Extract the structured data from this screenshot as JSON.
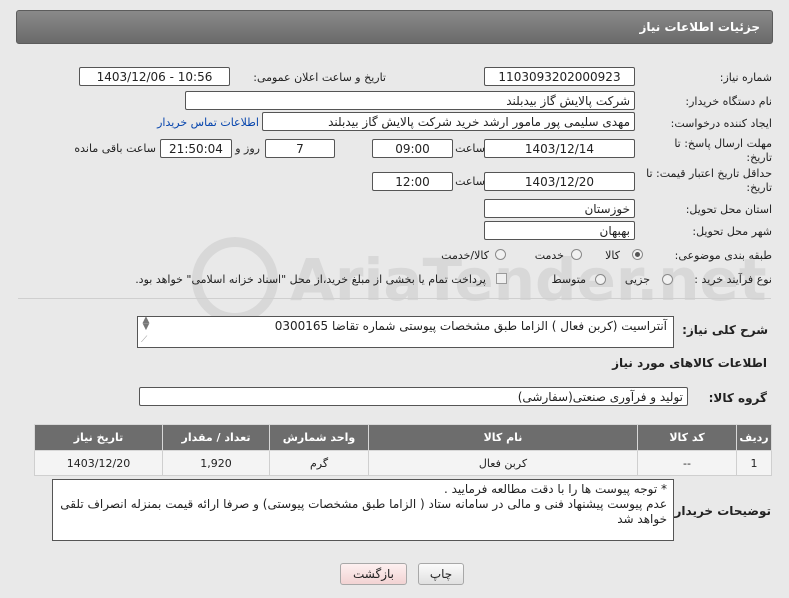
{
  "header": {
    "title": "جزئیات اطلاعات نیاز"
  },
  "form": {
    "need_number_label": "شماره نیاز:",
    "need_number": "1103093202000923",
    "announce_label": "تاریخ و ساعت اعلان عمومی:",
    "announce_value": "1403/12/06 - 10:56",
    "buyer_org_label": "نام دستگاه خریدار:",
    "buyer_org": "شرکت پالایش گاز بیدبلند",
    "creator_label": "ایجاد کننده درخواست:",
    "creator": "مهدی سلیمی پور مامور ارشد خرید شرکت پالایش گاز بیدبلند",
    "contact_link": "اطلاعات تماس خریدار",
    "deadline_label": "مهلت ارسال پاسخ: تا تاریخ:",
    "deadline_date": "1403/12/14",
    "time_label": "ساعت",
    "deadline_time": "09:00",
    "days_value": "7",
    "days_label": "روز و",
    "remaining_time": "21:50:04",
    "remaining_label": "ساعت باقی مانده",
    "price_validity_label": "حداقل تاریخ اعتبار قیمت: تا تاریخ:",
    "price_validity_date": "1403/12/20",
    "price_validity_time": "12:00",
    "province_label": "استان محل تحویل:",
    "province": "خوزستان",
    "city_label": "شهر محل تحویل:",
    "city": "بهبهان",
    "category_label": "طبقه بندی موضوعی:",
    "category_options": [
      "کالا",
      "خدمت",
      "کالا/خدمت"
    ],
    "purchase_type_label": "نوع فرآیند خرید :",
    "purchase_options": [
      "جزیی",
      "متوسط"
    ],
    "payment_note": "پرداخت تمام یا بخشی از مبلغ خرید،از محل \"اسناد خزانه اسلامی\" خواهد بود."
  },
  "description": {
    "label": "شرح کلی نیاز:",
    "text": "آنتراسیت (کربن فعال ) الزاما طبق مشخصات پیوستی شماره تقاضا 0300165"
  },
  "goods": {
    "section_title": "اطلاعات کالاهای مورد نیاز",
    "group_label": "گروه کالا:",
    "group_value": "تولید و فرآوری صنعتی(سفارشی)",
    "columns": [
      "ردیف",
      "کد کالا",
      "نام کالا",
      "واحد شمارش",
      "تعداد / مقدار",
      "تاریخ نیاز"
    ],
    "rows": [
      [
        "1",
        "--",
        "کربن فعال",
        "گرم",
        "1,920",
        "1403/12/20"
      ]
    ]
  },
  "buyer_notes": {
    "label": "توضیحات خریدار:",
    "line1": "* توجه پیوست ها  را با دقت مطالعه فرمایید .",
    "line2": "عدم پیوست پیشنهاد فنی و مالی در سامانه ستاد ( الزاما طبق مشخصات پیوستی)  و صرفا ارائه قیمت بمنزله انصراف تلقی",
    "line3": "خواهد شد"
  },
  "buttons": {
    "print": "چاپ",
    "back": "بازگشت"
  },
  "colors": {
    "header_bg": "#6f6f6f",
    "link": "#0645ad",
    "back_button_bg": "#f7dede"
  }
}
